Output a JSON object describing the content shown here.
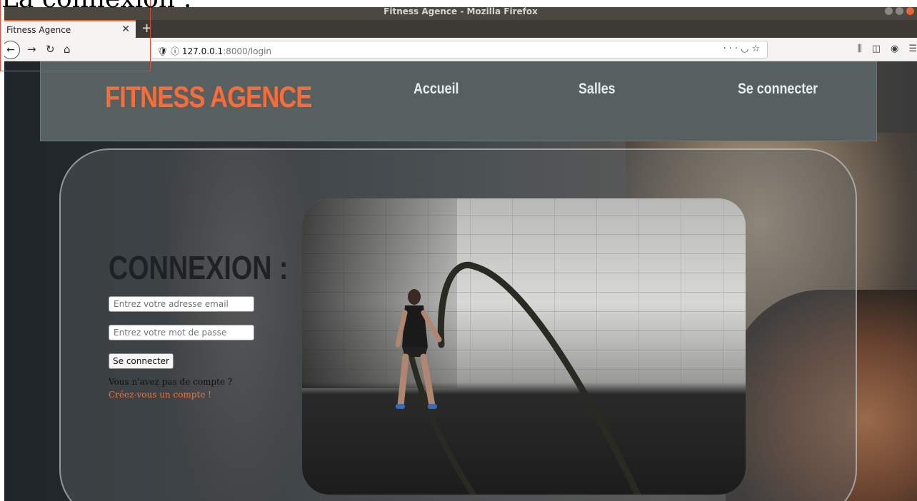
{
  "doc_heading": "La connexion :",
  "browser": {
    "window_title": "Fitness Agence - Mozilla Firefox",
    "tab_title": "Fitness Agence",
    "url_host": "127.0.0.1",
    "url_path": ":8000/login"
  },
  "site": {
    "logo": "FITNESS AGENCE",
    "nav": [
      "Accueil",
      "Salles",
      "Se connecter"
    ],
    "accent_color": "#ff6b35"
  },
  "login": {
    "title": "CONNEXION :",
    "email_placeholder": "Entrez votre adresse email",
    "password_placeholder": "Entrez votre mot de passe",
    "submit_label": "Se connecter",
    "no_account_text": "Vous n'avez pas de compte ?",
    "create_account_link": "Créez-vous un compte !"
  }
}
